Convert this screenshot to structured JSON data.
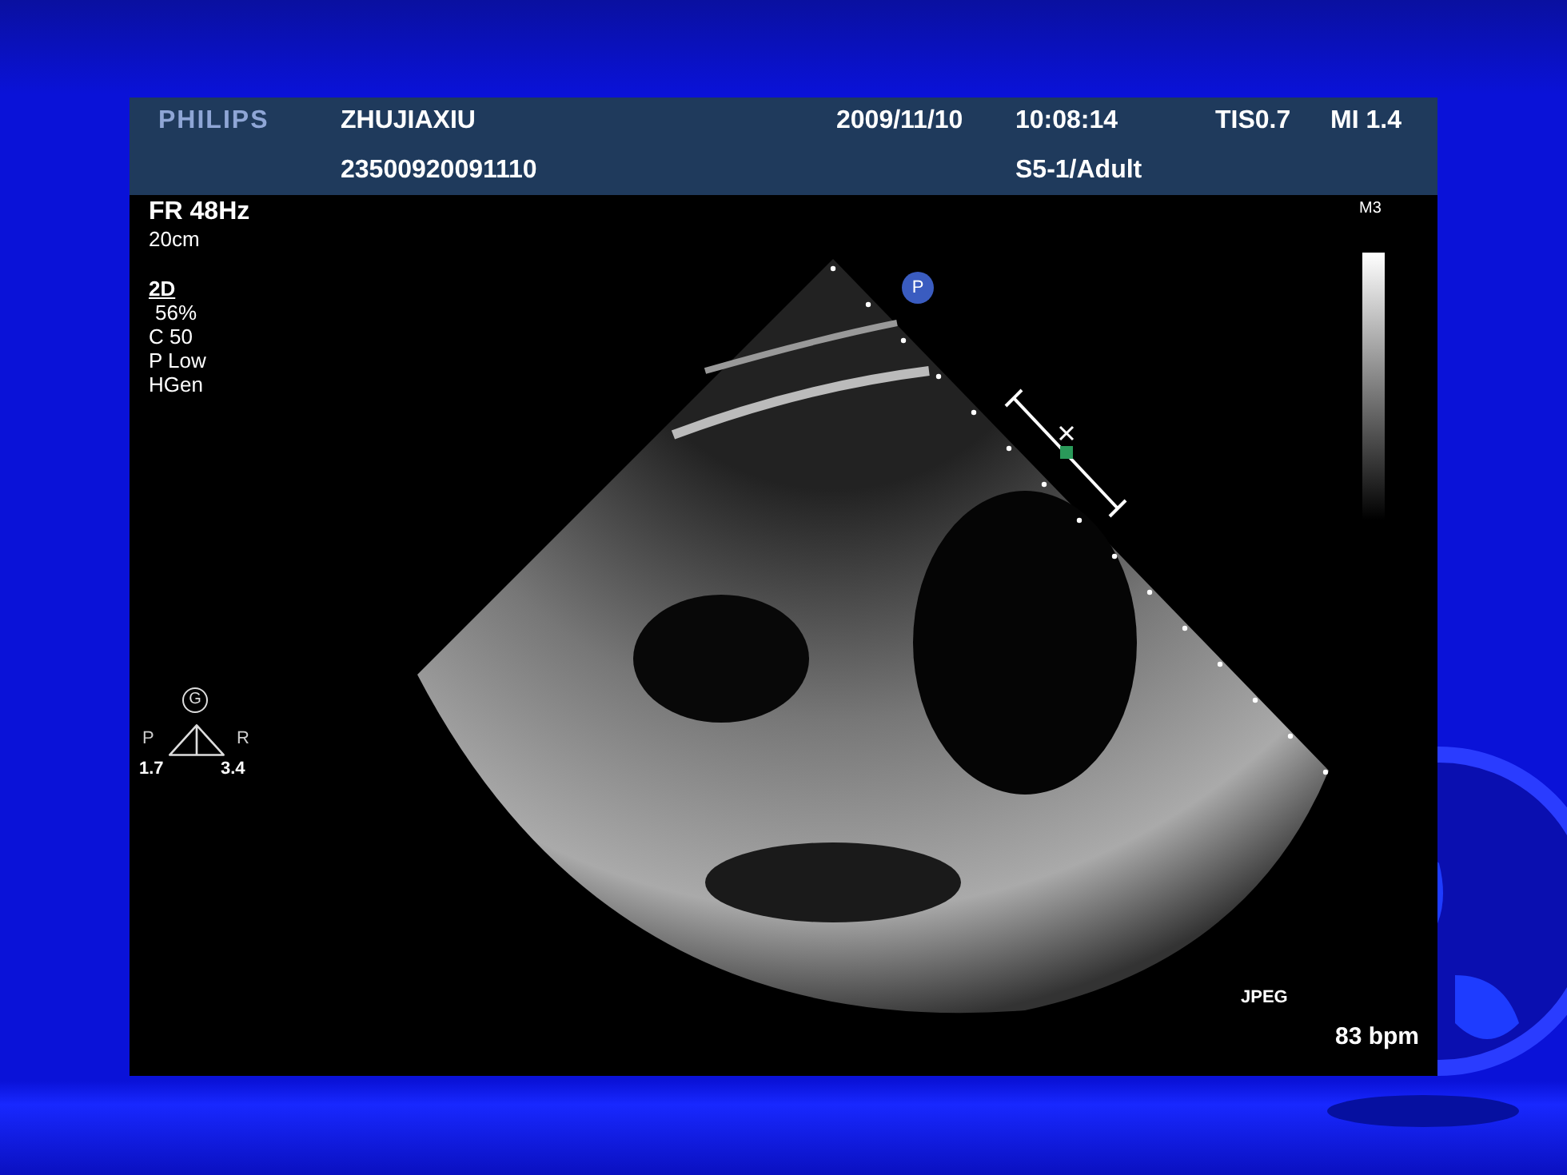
{
  "header": {
    "logo": "PHILIPS",
    "patient_name": "ZHUJIAXIU",
    "patient_id": "23500920091110",
    "date": "2009/11/10",
    "time": "10:08:14",
    "thermal_index": "TIS0.7",
    "mechanical_index": "MI 1.4",
    "preset": "S5-1/Adult"
  },
  "left_panel": [
    {
      "text": "FR 48Hz",
      "kind": "heading"
    },
    {
      "text": "20cm",
      "kind": "plain"
    },
    {
      "text": "2D",
      "kind": "mode"
    },
    {
      "text": "56%",
      "kind": "indent"
    },
    {
      "text": "C 50",
      "kind": "plain"
    },
    {
      "text": "P Low",
      "kind": "plain"
    },
    {
      "text": "HGen",
      "kind": "plain"
    }
  ],
  "map_label": "M3",
  "probe_marker": "P",
  "orientation_marker": {
    "symbol": "G",
    "left": "P",
    "right": "R",
    "left_value": "1.7",
    "right_value": "3.4"
  },
  "format": "JPEG",
  "heart_rate": "83 bpm"
}
